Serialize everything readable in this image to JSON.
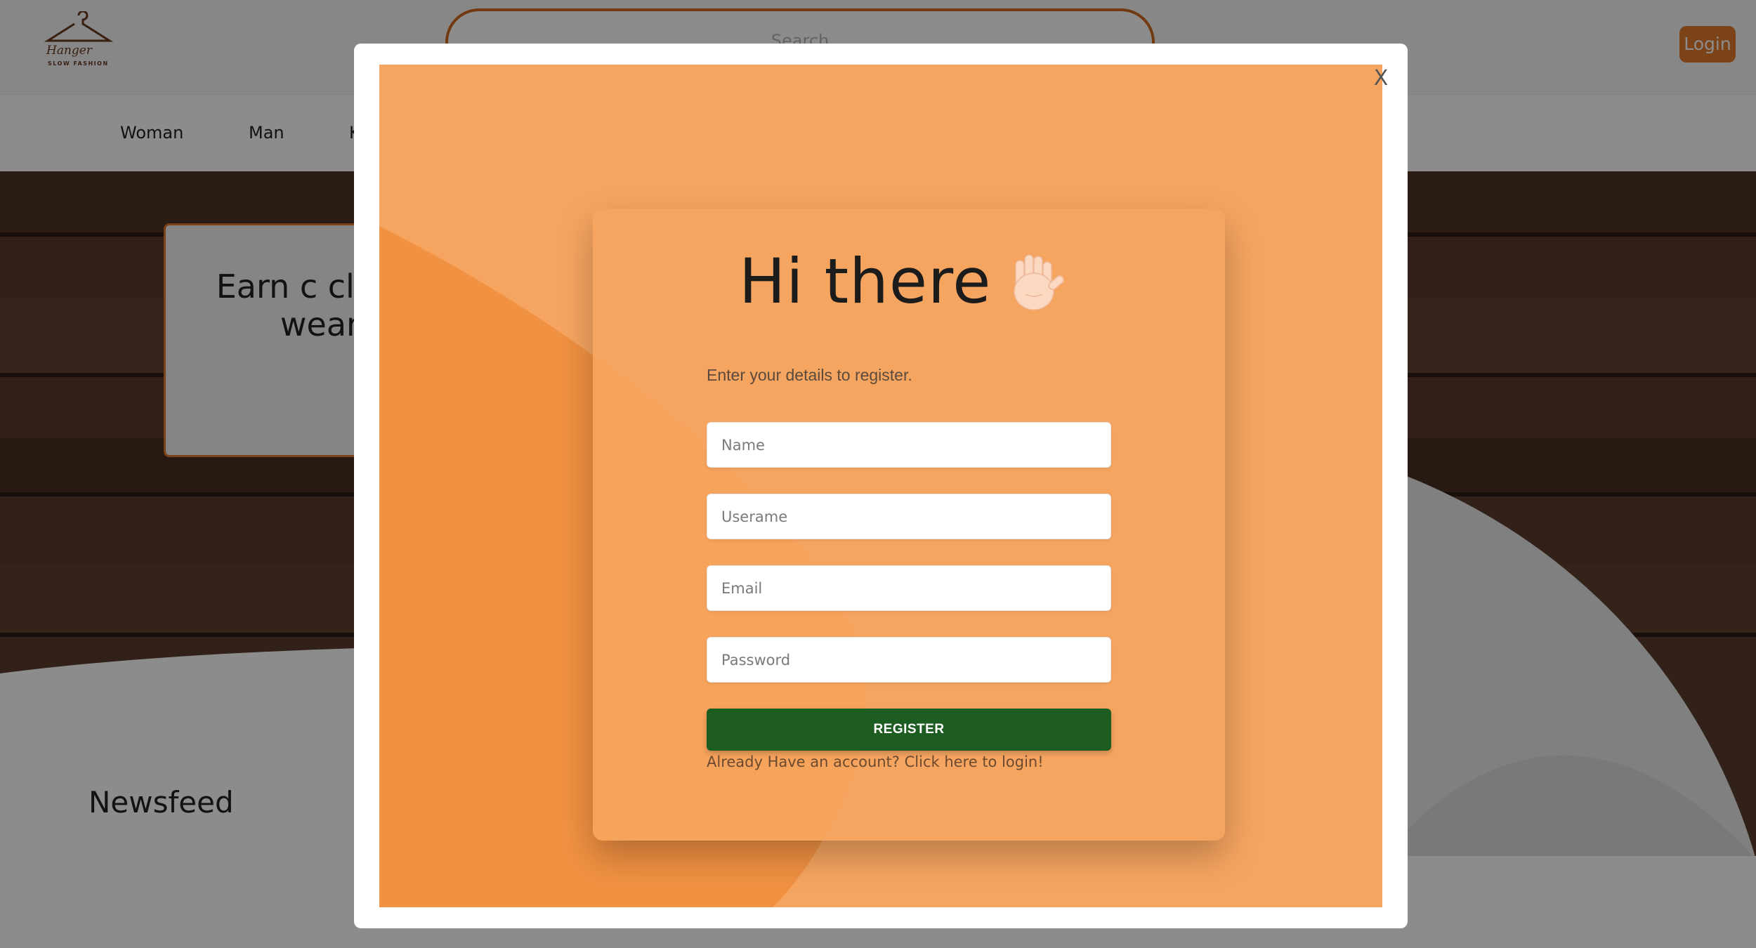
{
  "header": {
    "logo_script": "Hanger",
    "logo_tagline": "SLOW FASHION",
    "search_placeholder": "Search",
    "login_label": "Login"
  },
  "nav": {
    "items": [
      {
        "label": "Woman"
      },
      {
        "label": "Man"
      },
      {
        "label": "K"
      }
    ]
  },
  "hero": {
    "promo_text": "Earn c clothes y wearing"
  },
  "sections": {
    "newsfeed_title": "Newsfeed"
  },
  "modal": {
    "close_label": "X",
    "title": "Hi there",
    "icon": "waving-hand-icon",
    "subtitle": "Enter your details to register.",
    "fields": [
      {
        "name": "name",
        "placeholder": "Name"
      },
      {
        "name": "username",
        "placeholder": "Userame"
      },
      {
        "name": "email",
        "placeholder": "Email"
      },
      {
        "name": "password",
        "placeholder": "Password"
      }
    ],
    "register_label": "REGISTER",
    "login_link": "Already Have an account? Click here to login!"
  },
  "colors": {
    "accent": "#e07a2a",
    "modal_bg": "#f6a560",
    "button_green": "#1e5d22"
  }
}
